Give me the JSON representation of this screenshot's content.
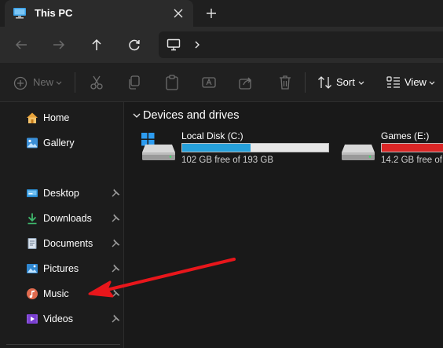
{
  "tab": {
    "title": "This PC"
  },
  "toolbar": {
    "new_label": "New",
    "sort_label": "Sort",
    "view_label": "View"
  },
  "sidebar": {
    "items": [
      {
        "label": "Home",
        "icon": "home-icon",
        "pinned": false
      },
      {
        "label": "Gallery",
        "icon": "gallery-icon",
        "pinned": false
      },
      {
        "label": "Desktop",
        "icon": "desktop-icon",
        "pinned": true
      },
      {
        "label": "Downloads",
        "icon": "download-icon",
        "pinned": true
      },
      {
        "label": "Documents",
        "icon": "documents-icon",
        "pinned": true
      },
      {
        "label": "Pictures",
        "icon": "pictures-icon",
        "pinned": true
      },
      {
        "label": "Music",
        "icon": "music-icon",
        "pinned": true
      },
      {
        "label": "Videos",
        "icon": "videos-icon",
        "pinned": true
      }
    ]
  },
  "main": {
    "section_title": "Devices and drives",
    "drives": [
      {
        "name": "Local Disk (C:)",
        "free_text": "102 GB free of 193 GB",
        "used_fraction": 0.47,
        "bar_color": "#26a0da"
      },
      {
        "name": "Games (E:)",
        "free_text": "14.2 GB free of",
        "used_fraction": 0.93,
        "bar_color": "#da2626"
      }
    ]
  },
  "colors": {
    "accent": "#26a0da",
    "warning": "#da2626",
    "annotation_arrow": "#e8161b"
  }
}
